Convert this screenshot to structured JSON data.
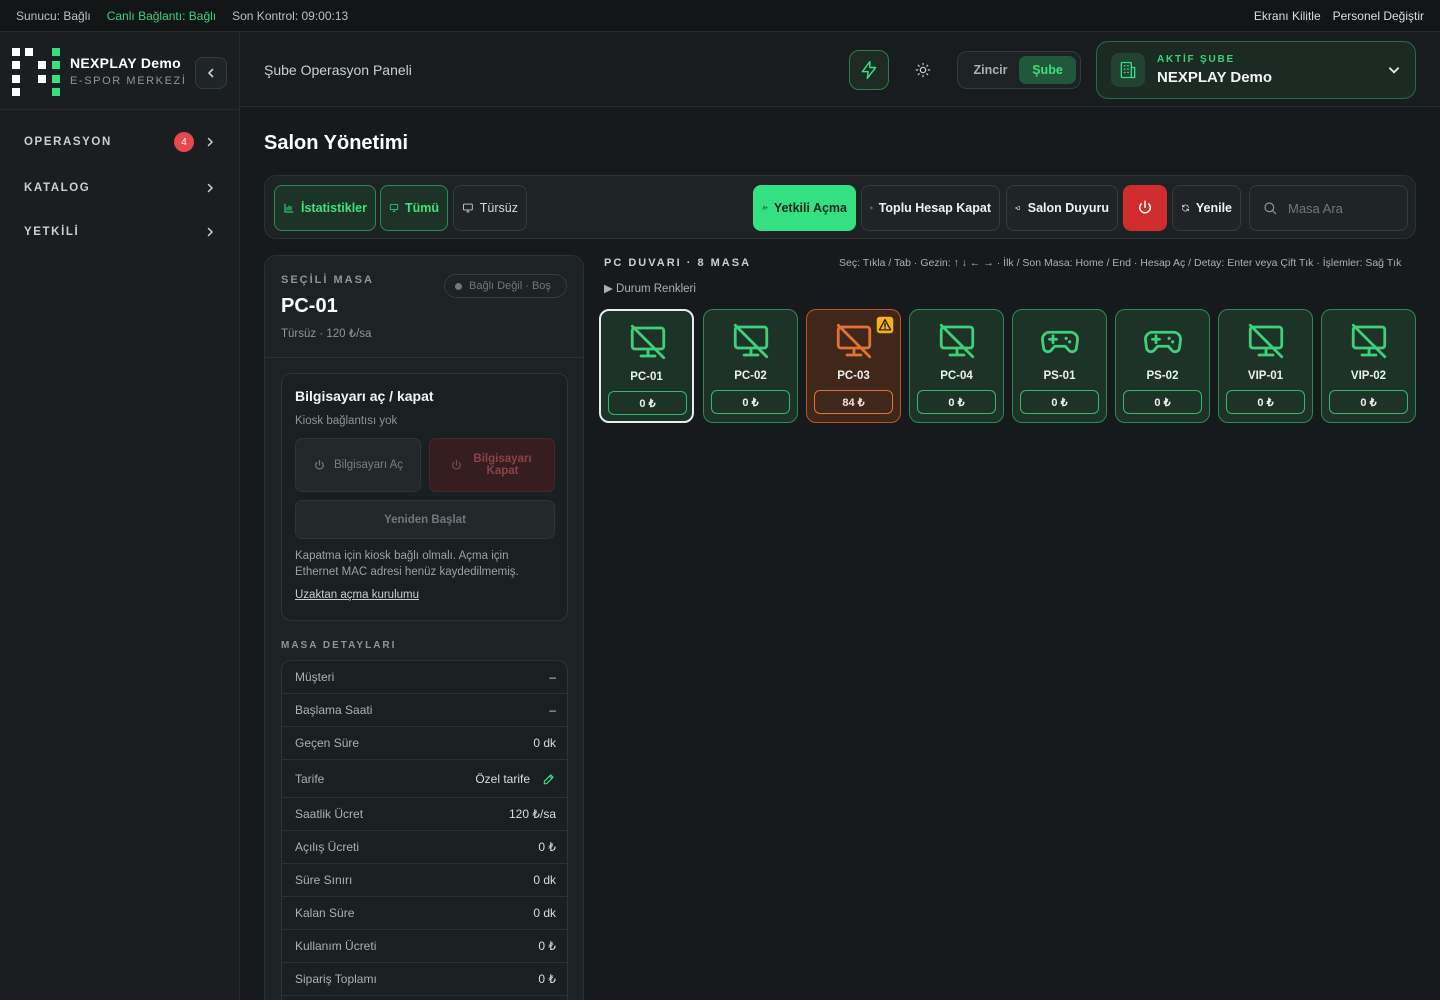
{
  "status_bar": {
    "server": "Sunucu: Bağlı",
    "live": "Canlı Bağlantı: Bağlı",
    "last_check": "Son Kontrol: 09:00:13",
    "lock_screen": "Ekranı Kilitle",
    "switch_staff": "Personel Değiştir"
  },
  "brand": {
    "name": "NEXPLAY Demo",
    "subtitle": "E-SPOR MERKEZİ"
  },
  "sidebar": {
    "items": [
      {
        "label": "OPERASYON",
        "badge": "4"
      },
      {
        "label": "KATALOG"
      },
      {
        "label": "YETKİLİ"
      }
    ]
  },
  "header": {
    "page_label": "Şube Operasyon Paneli",
    "scope": {
      "chain": "Zincir",
      "branch": "Şube",
      "active": "branch"
    },
    "active_branch_key": "AKTİF ŞUBE",
    "active_branch_name": "NEXPLAY Demo"
  },
  "main": {
    "title": "Salon Yönetimi",
    "toolbar": {
      "stats": "İstatistikler",
      "all": "Tümü",
      "no_tariff": "Türsüz",
      "auth_open": "Yetkili Açma",
      "bulk_close": "Toplu Hesap Kapat",
      "announce": "Salon Duyuru",
      "refresh": "Yenile",
      "search_placeholder": "Masa Ara"
    }
  },
  "selected": {
    "key": "SEÇİLİ MASA",
    "name": "PC-01",
    "meta": "Türsüz · 120 ₺/sa",
    "status": "Bağlı Değil · Boş",
    "power_card": {
      "title": "Bilgisayarı aç / kapat",
      "subtitle": "Kiosk bağlantısı yok",
      "open": "Bilgisayarı Aç",
      "close": "Bilgisayarı Kapat",
      "restart": "Yeniden Başlat",
      "note": "Kapatma için kiosk bağlı olmalı. Açma için Ethernet MAC adresi henüz kaydedilmemiş.",
      "link": "Uzaktan açma kurulumu"
    },
    "details_key": "MASA DETAYLARI",
    "details": [
      {
        "k": "Müşteri",
        "v": "–"
      },
      {
        "k": "Başlama Saati",
        "v": "–"
      },
      {
        "k": "Geçen Süre",
        "v": "0 dk"
      },
      {
        "k": "Tarife",
        "v": "Özel tarife"
      },
      {
        "k": "Saatlik Ücret",
        "v": "120 ₺/sa"
      },
      {
        "k": "Açılış Ücreti",
        "v": "0 ₺"
      },
      {
        "k": "Süre Sınırı",
        "v": "0 dk"
      },
      {
        "k": "Kalan Süre",
        "v": "0 dk"
      },
      {
        "k": "Kullanım Ücreti",
        "v": "0 ₺"
      },
      {
        "k": "Sipariş Toplamı",
        "v": "0 ₺"
      }
    ]
  },
  "wall": {
    "title": "PC DUVARI · 8 MASA",
    "hint": "Seç: Tıkla / Tab · Gezin: ↑ ↓ ← → · İlk / Son Masa: Home / End · Hesap Aç / Detay: Enter veya Çift Tık · İşlemler: Sağ Tık",
    "legend": "▶ Durum Renkleri",
    "tiles": [
      {
        "name": "PC-01",
        "price": "0 ₺",
        "icon": "monitor-off-icon"
      },
      {
        "name": "PC-02",
        "price": "0 ₺",
        "icon": "monitor-off-icon"
      },
      {
        "name": "PC-03",
        "price": "84 ₺",
        "icon": "monitor-off-icon"
      },
      {
        "name": "PC-04",
        "price": "0 ₺",
        "icon": "monitor-off-icon"
      },
      {
        "name": "PS-01",
        "price": "0 ₺",
        "icon": "gamepad-icon"
      },
      {
        "name": "PS-02",
        "price": "0 ₺",
        "icon": "gamepad-icon"
      },
      {
        "name": "VIP-01",
        "price": "0 ₺",
        "icon": "monitor-off-icon"
      },
      {
        "name": "VIP-02",
        "price": "0 ₺",
        "icon": "monitor-off-icon"
      }
    ]
  },
  "colors": {
    "accent": "#35e083",
    "danger": "#d02c2c",
    "warning": "#e07335",
    "background": "#161a1c"
  }
}
